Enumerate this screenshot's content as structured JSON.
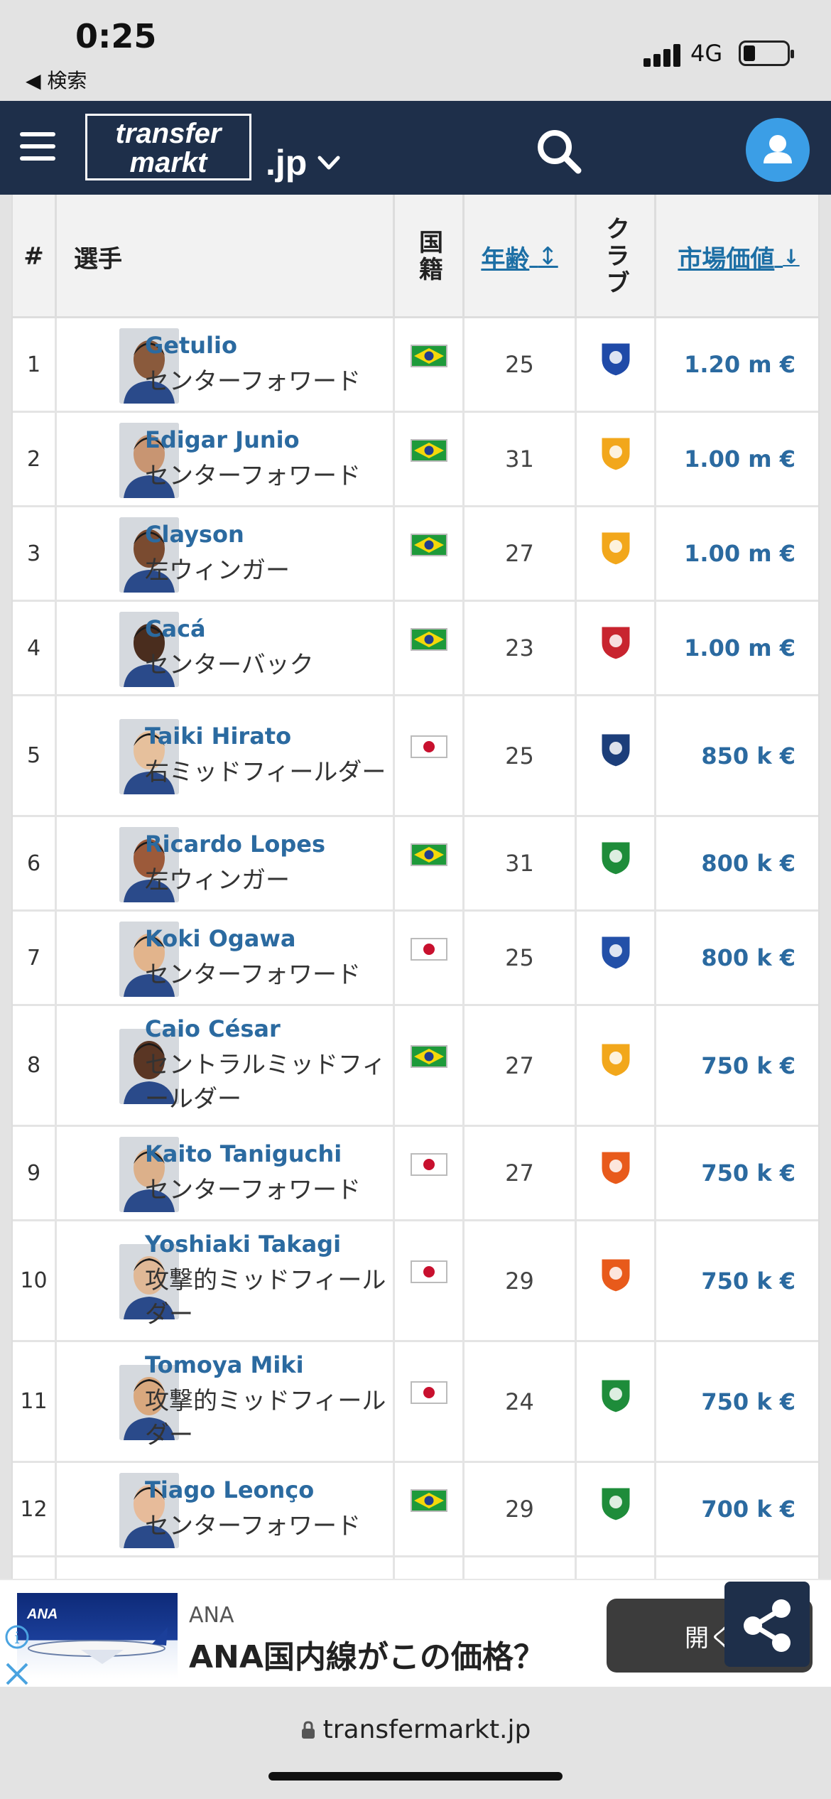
{
  "status": {
    "time": "0:25",
    "back_label": "◀ 検索",
    "network": "4G",
    "battery_level": 0.2
  },
  "nav": {
    "logo_line1": "transfer",
    "logo_line2": "markt",
    "domain": ".jp"
  },
  "table": {
    "headers": {
      "rank": "#",
      "player": "選手",
      "nationality": "国籍",
      "age": "年齢",
      "age_sort": "↕",
      "club": "クラブ",
      "value": "市場価値",
      "value_sort": "↓"
    },
    "rows": [
      {
        "rank": "1",
        "name": "Getulio",
        "position": "センターフォワード",
        "nationality": "brazil",
        "age": "25",
        "club_color": "#1f4aa8",
        "value": "1.20 m €"
      },
      {
        "rank": "2",
        "name": "Edigar Junio",
        "position": "センターフォワード",
        "nationality": "brazil",
        "age": "31",
        "club_color": "#f2a71b",
        "value": "1.00 m €"
      },
      {
        "rank": "3",
        "name": "Clayson",
        "position": "左ウィンガー",
        "nationality": "brazil",
        "age": "27",
        "club_color": "#f2a71b",
        "value": "1.00 m €"
      },
      {
        "rank": "4",
        "name": "Cacá",
        "position": "センターバック",
        "nationality": "brazil",
        "age": "23",
        "club_color": "#c8242f",
        "value": "1.00 m €"
      },
      {
        "rank": "5",
        "name": "Taiki Hirato",
        "position": "右ミッドフィールダー",
        "nationality": "japan",
        "age": "25",
        "club_color": "#1c3e7a",
        "value": "850 k €"
      },
      {
        "rank": "6",
        "name": "Ricardo Lopes",
        "position": "左ウィンガー",
        "nationality": "brazil",
        "age": "31",
        "club_color": "#1e8c3a",
        "value": "800 k €"
      },
      {
        "rank": "7",
        "name": "Koki Ogawa",
        "position": "センターフォワード",
        "nationality": "japan",
        "age": "25",
        "club_color": "#2350a8",
        "value": "800 k €"
      },
      {
        "rank": "8",
        "name": "Caio César",
        "position": "セントラルミッドフィールダー",
        "nationality": "brazil",
        "age": "27",
        "club_color": "#f2a71b",
        "value": "750 k €"
      },
      {
        "rank": "9",
        "name": "Kaito Taniguchi",
        "position": "センターフォワード",
        "nationality": "japan",
        "age": "27",
        "club_color": "#e85a1b",
        "value": "750 k €"
      },
      {
        "rank": "10",
        "name": "Yoshiaki Takagi",
        "position": "攻撃的ミッドフィールダー",
        "nationality": "japan",
        "age": "29",
        "club_color": "#e85a1b",
        "value": "750 k €"
      },
      {
        "rank": "11",
        "name": "Tomoya Miki",
        "position": "攻撃的ミッドフィールダー",
        "nationality": "japan",
        "age": "24",
        "club_color": "#1e8c3a",
        "value": "750 k €"
      },
      {
        "rank": "12",
        "name": "Tiago Leonço",
        "position": "センターフォワード",
        "nationality": "brazil",
        "age": "29",
        "club_color": "#1e8c3a",
        "value": "700 k €"
      }
    ]
  },
  "ad": {
    "brand": "ANA",
    "title": "ANA国内線がこの価格？",
    "open_label": "開く"
  },
  "browser": {
    "url": "transfermarkt.jp"
  }
}
